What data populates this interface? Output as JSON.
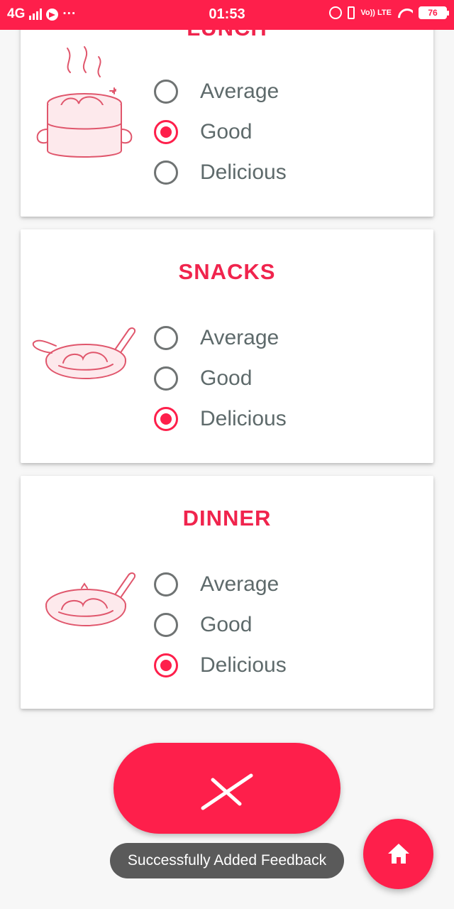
{
  "status_bar": {
    "network": "4G",
    "time": "01:53",
    "volte": "Vo)) LTE",
    "battery": "76"
  },
  "cards": [
    {
      "title": "LUNCH",
      "options": [
        "Average",
        "Good",
        "Delicious"
      ],
      "selected": "Good"
    },
    {
      "title": "SNACKS",
      "options": [
        "Average",
        "Good",
        "Delicious"
      ],
      "selected": "Delicious"
    },
    {
      "title": "DINNER",
      "options": [
        "Average",
        "Good",
        "Delicious"
      ],
      "selected": "Delicious"
    }
  ],
  "toast": {
    "message": "Successfully Added Feedback"
  },
  "icons": {
    "cancel": "close-icon",
    "home": "home-icon"
  },
  "colors": {
    "accent": "#fe1f4b",
    "title": "#f0244d",
    "option_text": "#5e6a6b",
    "radio_off": "#6f7373",
    "toast_bg": "#5a5a5a"
  }
}
